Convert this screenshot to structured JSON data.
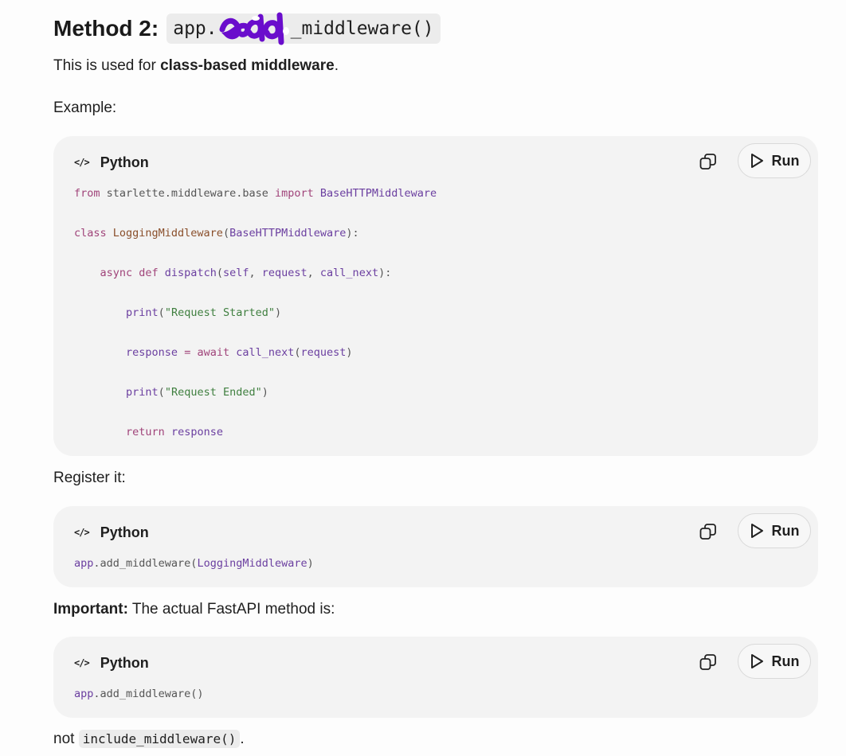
{
  "heading": {
    "prefix": "Method 2:",
    "code_start": "app.",
    "code_end": "_middleware()"
  },
  "intro": {
    "text_before": "This is used for ",
    "bold": "class-based middleware",
    "text_after": "."
  },
  "example_label": "Example:",
  "code_blocks": [
    {
      "language": "Python",
      "lang_icon": "</>",
      "run_label": "Run"
    },
    {
      "language": "Python",
      "lang_icon": "</>",
      "run_label": "Run"
    },
    {
      "language": "Python",
      "lang_icon": "</>",
      "run_label": "Run"
    }
  ],
  "code1": {
    "l1": {
      "a": "from",
      "b": " starlette.middleware.base ",
      "c": "import",
      "d": " BaseHTTPMiddleware"
    },
    "l2": {
      "a": "class",
      "b": " LoggingMiddleware",
      "c": "(",
      "d": "BaseHTTPMiddleware",
      "e": "):"
    },
    "l3": {
      "indent": "    ",
      "a": "async",
      "b": " def",
      "c": " dispatch",
      "d": "(",
      "e": "self",
      "f": ", ",
      "g": "request",
      "h": ", ",
      "i": "call_next",
      "j": "):"
    },
    "l4": {
      "indent": "        ",
      "a": "print",
      "b": "(",
      "c": "\"Request Started\"",
      "d": ")"
    },
    "l5": {
      "indent": "        ",
      "a": "response",
      "b": " = ",
      "c": "await",
      "d": " call_next",
      "e": "(",
      "f": "request",
      "g": ")"
    },
    "l6": {
      "indent": "        ",
      "a": "print",
      "b": "(",
      "c": "\"Request Ended\"",
      "d": ")"
    },
    "l7": {
      "indent": "        ",
      "a": "return",
      "b": " response"
    }
  },
  "register_label": "Register it:",
  "code2": {
    "a": "app",
    "b": ".add_middleware(",
    "c": "LoggingMiddleware",
    "d": ")"
  },
  "important": {
    "bold": "Important:",
    "text": " The actual FastAPI method is:"
  },
  "code3": {
    "a": "app",
    "b": ".add_middleware()"
  },
  "footer": {
    "text_before": "not ",
    "code": "include_middleware()",
    "text_after": "."
  },
  "icons": [
    "code-icon",
    "copy-icon",
    "play-icon"
  ],
  "colors": {
    "keyword": "#a0447a",
    "class": "#6b3fa0",
    "string": "#3f7f3f",
    "scribble": "#6a0dcc"
  }
}
